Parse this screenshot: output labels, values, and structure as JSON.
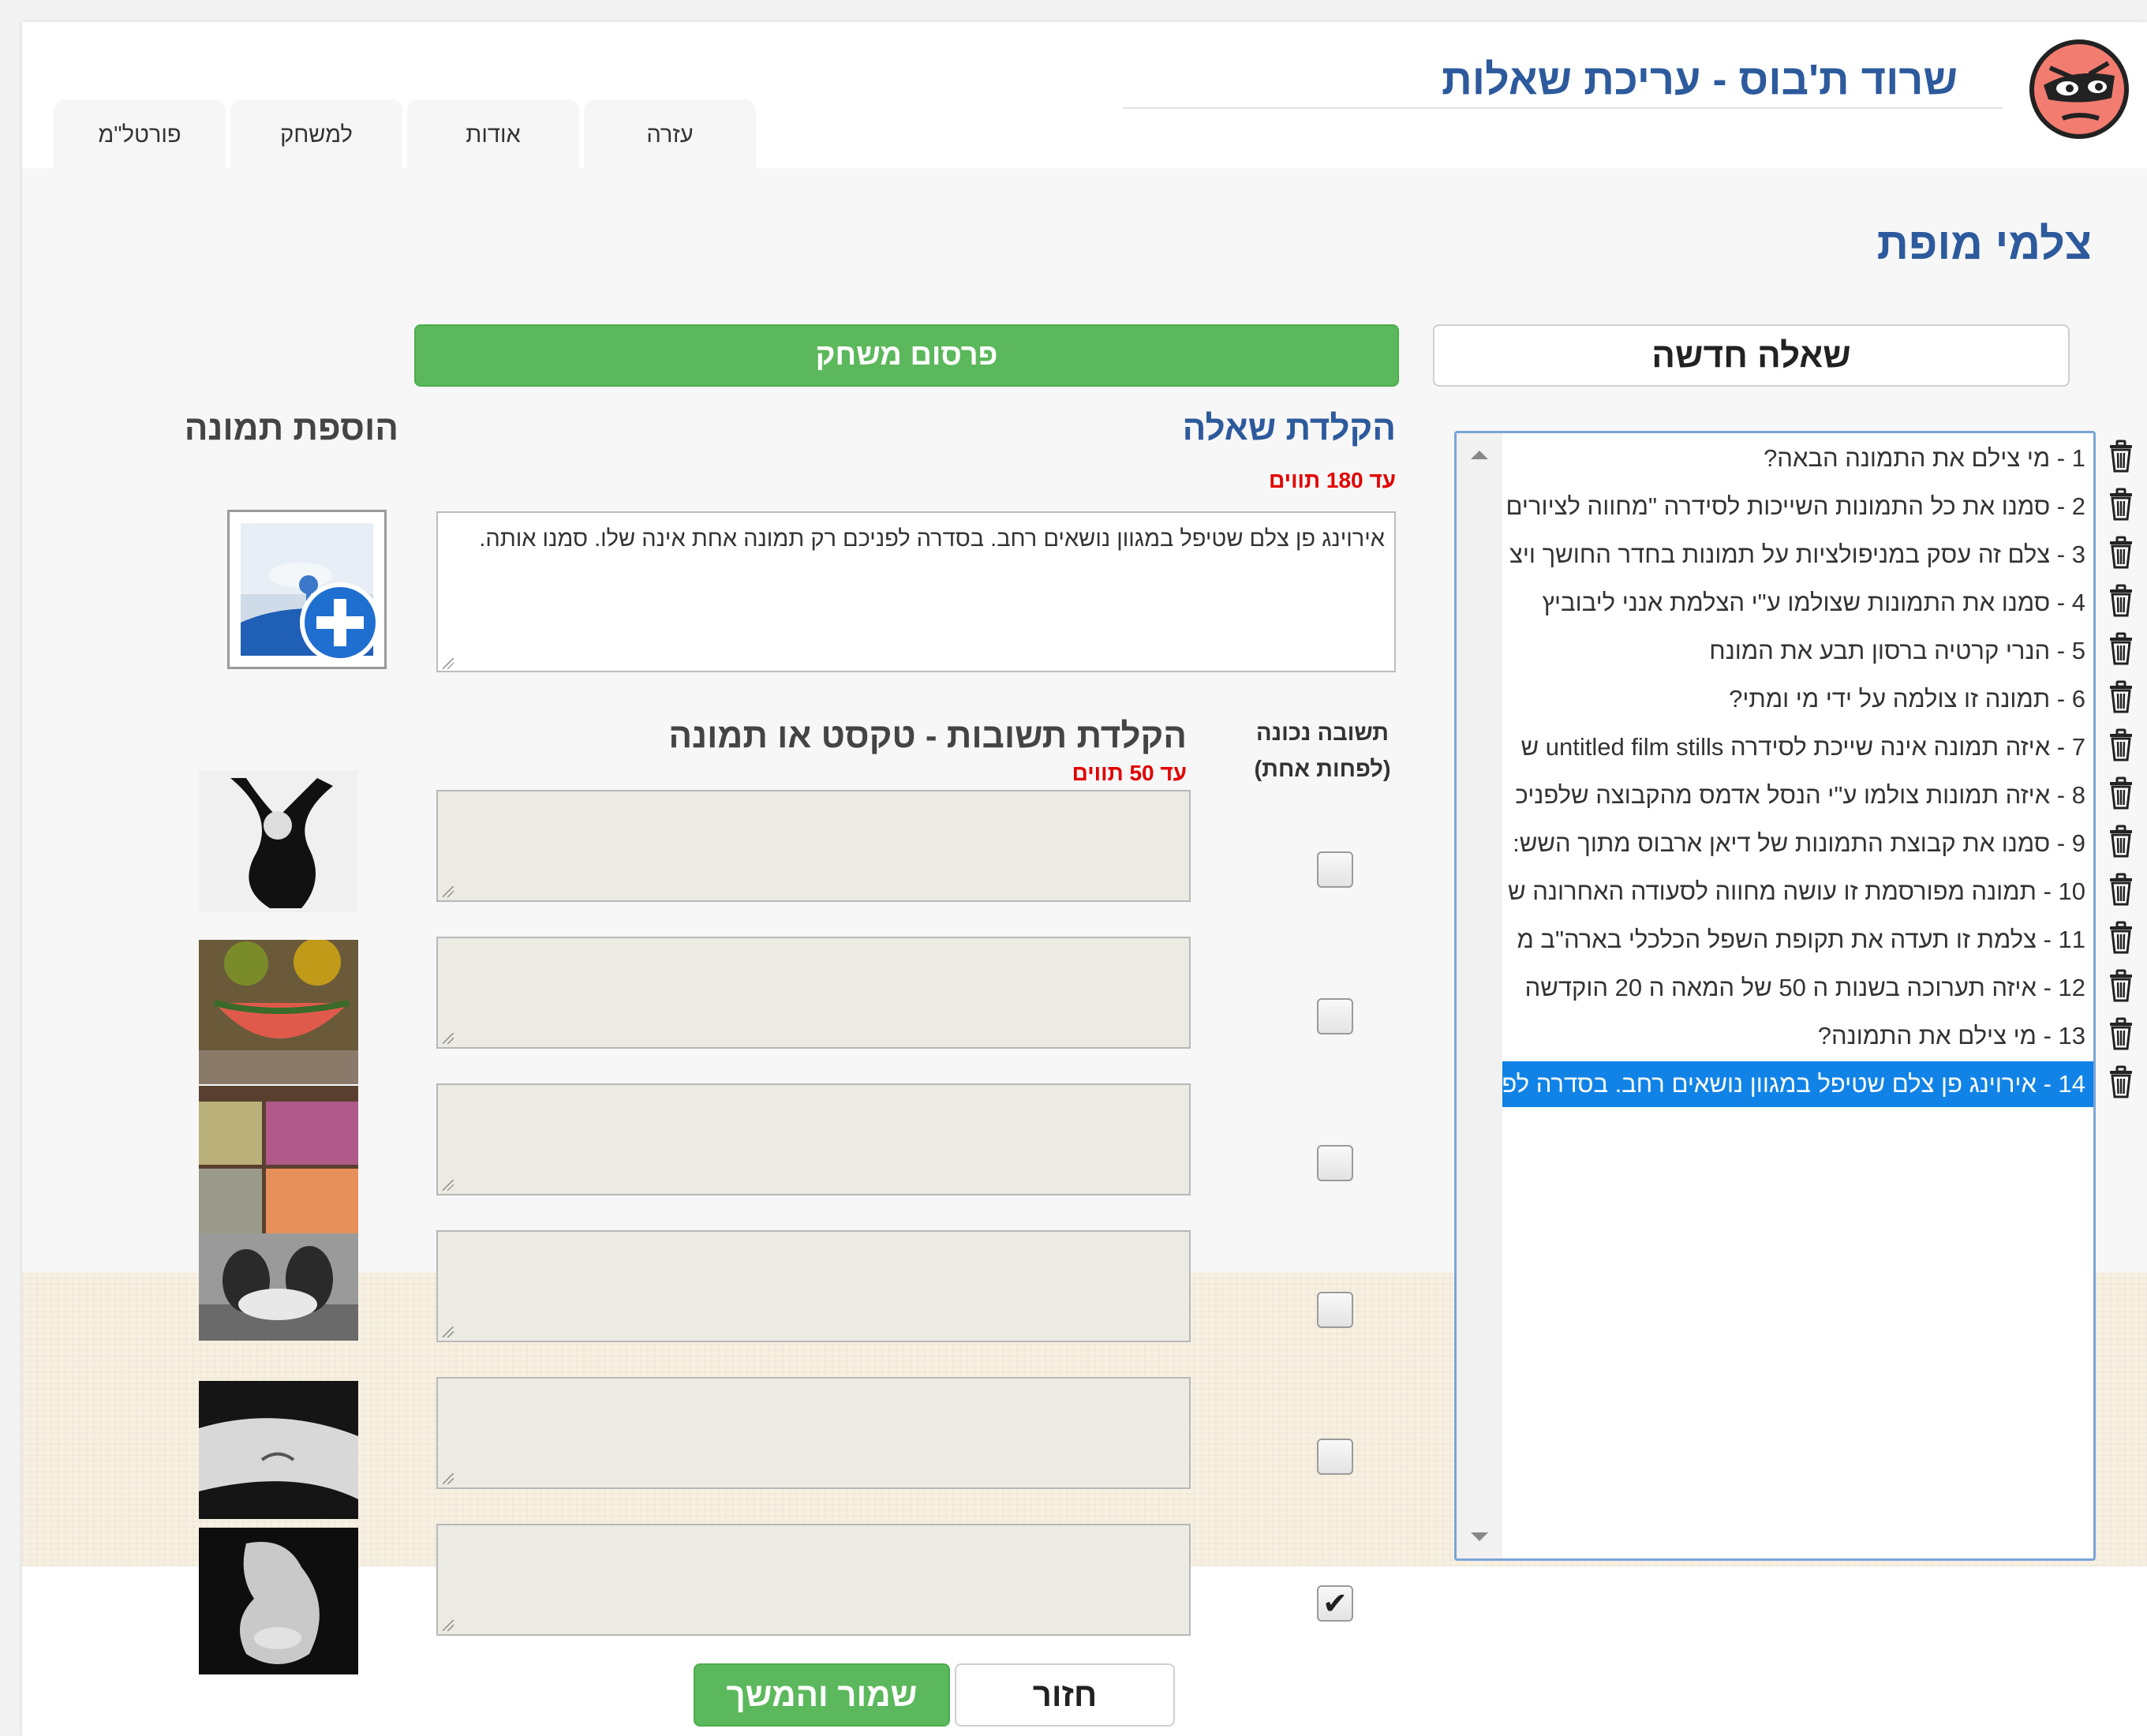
{
  "app": {
    "title": "שרוד ת'בוס - עריכת שאלות",
    "logo_icon": "angry-face-logo",
    "accent_color": "#2d5a9c"
  },
  "nav": {
    "tabs": [
      {
        "label": "עזרה"
      },
      {
        "label": "אודות"
      },
      {
        "label": "למשחק"
      },
      {
        "label": "פורטל\"מ"
      }
    ]
  },
  "page": {
    "heading": "צלמי מופת"
  },
  "sidebar": {
    "new_question_label": "שאלה חדשה",
    "questions": [
      {
        "label": "1 - מי צילם את התמונה הבאה?",
        "selected": false
      },
      {
        "label": "2 - סמנו את כל התמונות השייכות לסידרה \"מחווה לציורים",
        "selected": false
      },
      {
        "label": "3 - צלם זה עסק במניפולציות על תמונות בחדר החושך ויצ",
        "selected": false
      },
      {
        "label": "4 - סמנו את התמונות שצולמו ע\"י הצלמת אנני ליבוביץ",
        "selected": false
      },
      {
        "label": "5 - הנרי קרטיה ברסון תבע את המונח",
        "selected": false
      },
      {
        "label": "6 - תמונה זו צולמה על ידי מי ומתי?",
        "selected": false
      },
      {
        "label": "7 - איזה תמונה אינה שייכת לסידרה untitled film stills ש",
        "selected": false
      },
      {
        "label": "8 - איזה תמונות צולמו ע\"י הנסל אדמס מהקבוצה שלפניכ",
        "selected": false
      },
      {
        "label": "9 - סמנו את קבוצת התמונות של דיאן ארבוס מתוך השש:",
        "selected": false
      },
      {
        "label": "10 - תמונה מפורסמת זו עושה מחווה לסעודה האחרונה ש",
        "selected": false
      },
      {
        "label": "11 - צלמת זו תעדה את תקופת השפל הכלכלי בארה\"ב מ",
        "selected": false
      },
      {
        "label": "12 - איזה תערוכה בשנות ה 50 של המאה ה 20 הוקדשה",
        "selected": false
      },
      {
        "label": "13 - מי צילם את התמונה?",
        "selected": false
      },
      {
        "label": "14 - אירוינג פן צלם שטיפל במגוון נושאים רחב. בסדרה לפ",
        "selected": true
      }
    ],
    "trash_icon": "trash-icon",
    "selected_color": "#1183e6"
  },
  "editor": {
    "publish_label": "פרסום משחק",
    "question_heading": "הקלדת שאלה",
    "question_limit": "עד 180 תווים",
    "question_text": "אירוינג פן צלם שטיפל במגוון נושאים רחב. בסדרה לפניכם רק תמונה אחת אינה שלו. סמנו אותה.",
    "add_image_heading": "הוספת תמונה",
    "answers_heading": "הקלדת תשובות - טקסט או תמונה",
    "answers_limit": "עד 50 תווים",
    "correct_label_line1": "תשובה נכונה",
    "correct_label_line2": "(לפחות אחת)",
    "answers": [
      {
        "text": "",
        "correct": false
      },
      {
        "text": "",
        "correct": false
      },
      {
        "text": "",
        "correct": false
      },
      {
        "text": "",
        "correct": false
      },
      {
        "text": "",
        "correct": false
      },
      {
        "text": "",
        "correct": true
      }
    ],
    "back_label": "חזור",
    "save_label": "שמור והמשך",
    "button_green": "#5cb85c",
    "limit_color": "#e20000"
  }
}
